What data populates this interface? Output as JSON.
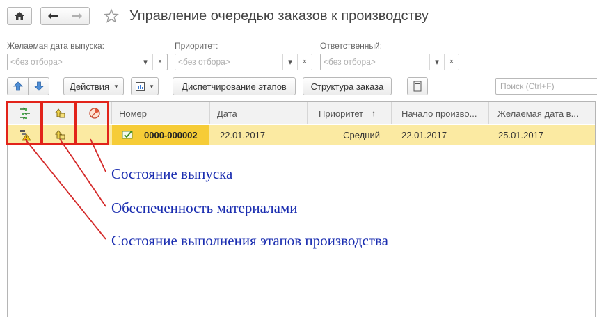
{
  "header": {
    "title": "Управление очередью заказов к производству"
  },
  "filters": {
    "release_date": {
      "label": "Желаемая дата выпуска:",
      "placeholder": "<без отбора>"
    },
    "priority": {
      "label": "Приоритет:",
      "placeholder": "<без отбора>"
    },
    "responsible": {
      "label": "Ответственный:",
      "placeholder": "<без отбора>"
    },
    "clear_symbol": "×",
    "dropdown_symbol": "▾"
  },
  "toolbar": {
    "actions_label": "Действия",
    "dispatch_label": "Диспетчирование этапов",
    "structure_label": "Структура заказа",
    "search_placeholder": "Поиск (Ctrl+F)"
  },
  "table": {
    "columns": {
      "number": "Номер",
      "date": "Дата",
      "priority": "Приоритет",
      "sort_arrow": "↑",
      "start": "Начало произво...",
      "desired_date": "Желаемая дата в..."
    },
    "rows": [
      {
        "number": "0000-000002",
        "date": "22.01.2017",
        "priority": "Средний",
        "start": "22.01.2017",
        "desired_date": "25.01.2017"
      }
    ]
  },
  "annotations": {
    "release_state": "Состояние выпуска",
    "materials": "Обеспеченность материалами",
    "stages": "Состояние выполнения этапов производства"
  },
  "colors": {
    "accent_red": "#e2231a",
    "annotation_blue": "#1a2db0",
    "row_highlight": "#fbeaa2",
    "number_cell": "#f6cc37"
  }
}
